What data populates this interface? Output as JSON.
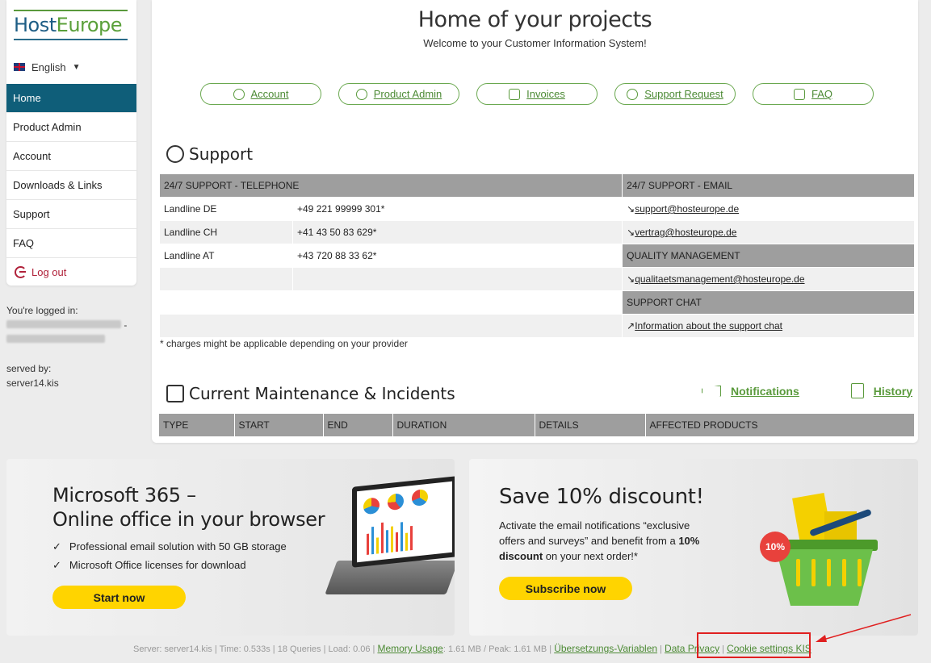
{
  "brand": {
    "logo_prefix": "H",
    "logo_main": "ost",
    "logo_suffix": "Europe"
  },
  "language": {
    "label": "English"
  },
  "sidebar": {
    "items": [
      {
        "label": "Home",
        "active": true
      },
      {
        "label": "Product Admin"
      },
      {
        "label": "Account"
      },
      {
        "label": "Downloads & Links"
      },
      {
        "label": "Support"
      },
      {
        "label": "FAQ"
      }
    ],
    "logout": "Log out"
  },
  "session": {
    "logged_in_label": "You're logged in:",
    "served_by_label": "served by:",
    "server": "server14.kis"
  },
  "main": {
    "title": "Home of your projects",
    "welcome": "Welcome to your Customer Information System!",
    "quick_links": [
      "Account",
      "Product Admin",
      "Invoices",
      "Support Request",
      "FAQ"
    ]
  },
  "support": {
    "title": "Support",
    "phone_header": "24/7 SUPPORT - TELEPHONE",
    "email_header": "24/7 SUPPORT - EMAIL",
    "phones": [
      {
        "label": "Landline DE",
        "number": "+49 221 99999 301*"
      },
      {
        "label": "Landline CH",
        "number": "+41 43 50 83 629*"
      },
      {
        "label": "Landline AT",
        "number": "+43 720 88 33 62*"
      }
    ],
    "emails": [
      "support@hosteurope.de",
      "vertrag@hosteurope.de"
    ],
    "quality_header": "QUALITY MANAGEMENT",
    "quality_email": "qualitaetsmanagement@hosteurope.de",
    "chat_header": "SUPPORT CHAT",
    "chat_link": "Information about the support chat",
    "note": "* charges might be applicable depending on your provider"
  },
  "maintenance": {
    "title": "Current Maintenance & Incidents",
    "notifications": "Notifications",
    "history": "History",
    "columns": [
      "TYPE",
      "START",
      "END",
      "DURATION",
      "DETAILS",
      "AFFECTED PRODUCTS"
    ]
  },
  "promo_ms": {
    "title_line1": "Microsoft 365 –",
    "title_line2": "Online office in your browser",
    "bullets": [
      "Professional email solution with 50 GB storage",
      "Microsoft Office licenses for download"
    ],
    "cta": "Start now"
  },
  "promo_discount": {
    "title": "Save 10% discount!",
    "text_pre": "Activate the email notifications “exclusive offers and surveys” and benefit from a ",
    "text_bold": "10% discount",
    "text_post": " on your next order!*",
    "cta": "Subscribe now",
    "badge": "10%"
  },
  "footer": {
    "stats": "Server: server14.kis | Time: 0.533s | 18 Queries | Load: 0.06 |",
    "memory_link": "Memory Usage",
    "memory_stats": ": 1.61 MB / Peak: 1.61 MB |",
    "translation_link": "Übersetzungs-Variablen",
    "privacy_link": "Data Privacy",
    "cookie_link": "Cookie settings KIS"
  },
  "colors": {
    "accent_green": "#5a9a3c",
    "nav_active": "#0f5e79",
    "cta_yellow": "#ffd400",
    "annotation_red": "#e02020"
  }
}
